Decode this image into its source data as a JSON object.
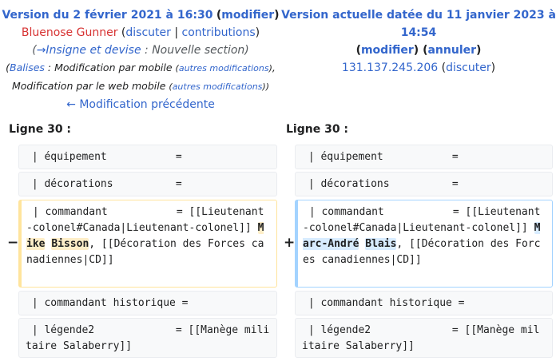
{
  "left_header": {
    "version_title": "Version du 2 février 2021 à 16:30",
    "modify_label": "modifier",
    "user": "Bluenose Gunner",
    "talk_label": "discuter",
    "contribs_label": "contributions",
    "summary_link": "→Insigne et devise",
    "summary_text": "Nouvelle section",
    "tags_link": "Balises",
    "tag_1": "Modification par mobile",
    "tag_1_more": "autres modifications",
    "tag_2": "Modification par le web mobile",
    "tag_2_more": "autres modifications",
    "prev_diff": "← Modification précédente"
  },
  "right_header": {
    "version_title": "Version actuelle datée du 11 janvier 2023 à 14:54",
    "modify_label": "modifier",
    "undo_label": "annuler",
    "ip": "131.137.245.206",
    "talk_label": "discuter"
  },
  "line_label": "Ligne 30 :",
  "rows": {
    "equip": " | équipement           =",
    "decor": " | décorations          =",
    "cmd_hist": " | commandant historique =",
    "legend": " | légende2             = [[Manège militaire Salaberry]]"
  },
  "changed": {
    "prefix": " | commandant           = [[Lieutenant-colonel#Canada|Lieutenant-colonel]] ",
    "old_first": "Mike",
    "old_last": "Bisson",
    "new_first": "Marc-André",
    "new_last": "Blais",
    "suffix": ", [[Décoration des Forces canadiennes|CD]]",
    "minus_sign": "−",
    "plus_sign": "+"
  }
}
